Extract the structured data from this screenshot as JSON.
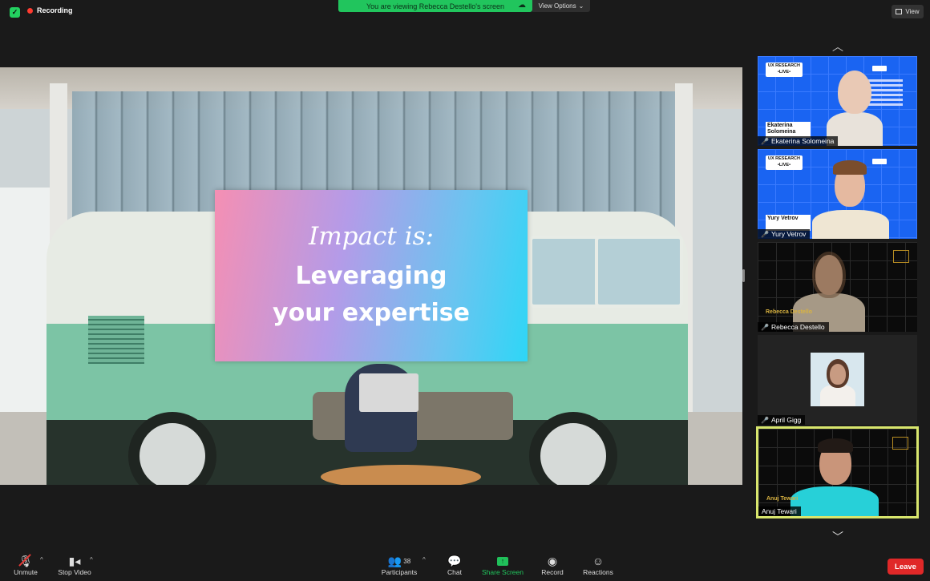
{
  "top_bar": {
    "recording_label": "Recording",
    "viewing_banner": "You are viewing Rebecca Destello's screen",
    "view_options_label": "View Options",
    "view_label": "View"
  },
  "slide": {
    "title": "Impact is:",
    "line1": "Leveraging",
    "line2": "your expertise"
  },
  "gallery": {
    "participants": [
      {
        "name": "Ekaterina Solomeina",
        "overlay_label": "Ekaterina Solomeina",
        "badge": "UX RESEARCH •LIVE•"
      },
      {
        "name": "Yury Vetrov",
        "overlay_label": "Yury Vetrov",
        "badge": "UX RESEARCH •LIVE•"
      },
      {
        "name": "Rebecca Destello",
        "overlay_label": "Rebecca Destello"
      },
      {
        "name": "April Gigg"
      },
      {
        "name": "Anuj Tewari",
        "overlay_label": "Anuj Tewari"
      }
    ]
  },
  "toolbar": {
    "unmute_label": "Unmute",
    "stop_video_label": "Stop Video",
    "participants_label": "Participants",
    "participants_count": "38",
    "chat_label": "Chat",
    "share_screen_label": "Share Screen",
    "record_label": "Record",
    "reactions_label": "Reactions",
    "leave_label": "Leave"
  },
  "colors": {
    "share_green": "#21c55d",
    "leave_red": "#e02828",
    "active_speaker_border": "#d8e66d",
    "recording_dot": "#ff3b30"
  },
  "icons": [
    "shield-icon",
    "recording-dot-icon",
    "cloud-icon",
    "chevron-down-icon",
    "view-grid-icon",
    "chevron-up-icon",
    "mic-muted-icon",
    "camera-icon",
    "participants-icon",
    "chat-icon",
    "share-screen-icon",
    "record-icon",
    "reactions-icon"
  ]
}
